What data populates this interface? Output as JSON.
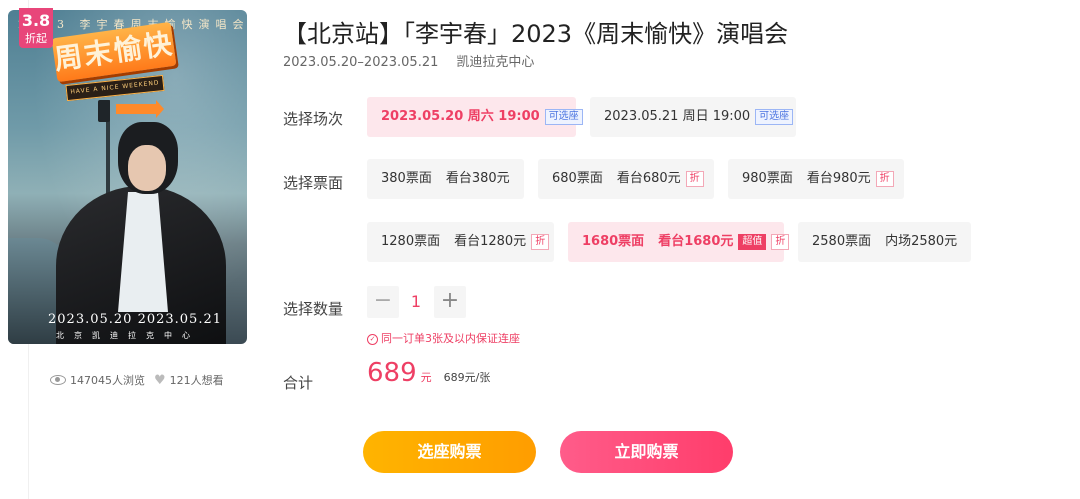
{
  "poster": {
    "badge_num": "3.8",
    "badge_text": "折起",
    "top_text": "2023 李宇春周末愉快演唱会",
    "logo_text": "周末愉快",
    "sub_banner": "HAVE A NICE WEEKEND",
    "dates": "2023.05.20   2023.05.21",
    "venue": "北京凯迪拉克中心"
  },
  "stats": {
    "views": "147045人浏览",
    "wants": "121人想看"
  },
  "event": {
    "title": "【北京站】「李宇春」2023《周末愉快》演唱会",
    "date_range": "2023.05.20–2023.05.21",
    "venue": "凯迪拉克中心"
  },
  "labels": {
    "session": "选择场次",
    "price": "选择票面",
    "quantity": "选择数量",
    "total": "合计"
  },
  "sessions": [
    {
      "text": "2023.05.20 周六 19:00",
      "tag": "可选座"
    },
    {
      "text": "2023.05.21 周日 19:00",
      "tag": "可选座"
    }
  ],
  "prices": [
    {
      "face": "380票面",
      "area": "看台380元"
    },
    {
      "face": "680票面",
      "area": "看台680元",
      "tag": "折"
    },
    {
      "face": "980票面",
      "area": "看台980元",
      "tag": "折"
    },
    {
      "face": "1280票面",
      "area": "看台1280元",
      "tag": "折"
    },
    {
      "face": "1680票面",
      "area": "看台1680元",
      "tag_hot": "超值",
      "tag": "折"
    },
    {
      "face": "2580票面",
      "area": "内场2580元"
    }
  ],
  "quantity": {
    "minus": "−",
    "value": "1",
    "plus": "+"
  },
  "note": {
    "icon": "✓",
    "text": "同一订单3张及以内保证连座"
  },
  "total": {
    "amount": "689",
    "unit": "元",
    "per": "689元/张"
  },
  "buttons": {
    "seat": "选座购票",
    "buy": "立即购票"
  },
  "colors": {
    "accent": "#ee3f64",
    "seat_button": "#ffa800",
    "buy_button": "#ff4a78"
  }
}
